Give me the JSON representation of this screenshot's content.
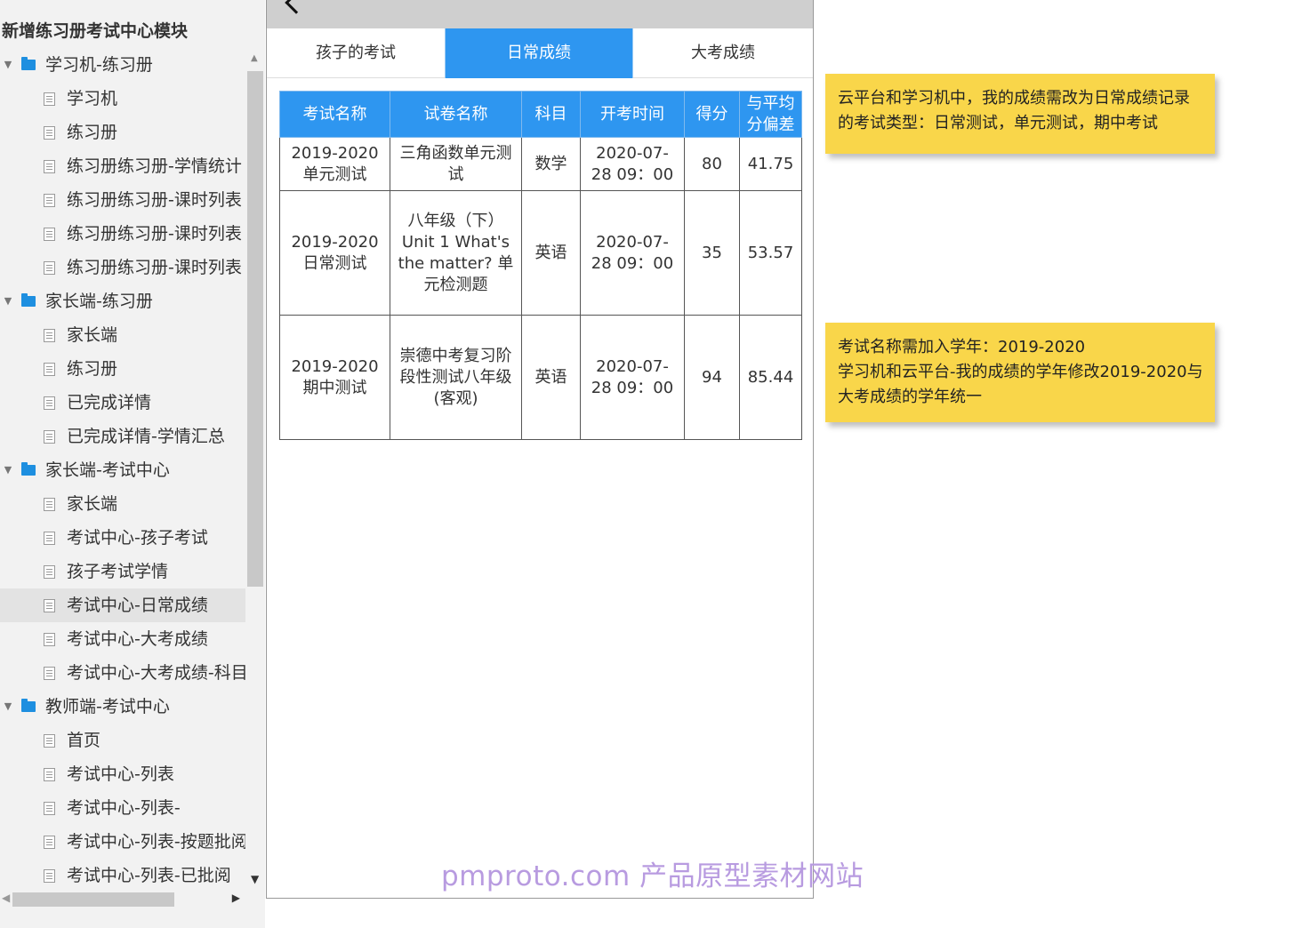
{
  "sidebar": {
    "title": "新增练习册考试中心模块",
    "tree": [
      {
        "type": "folder",
        "label": "学习机-练习册"
      },
      {
        "type": "page",
        "label": "学习机"
      },
      {
        "type": "page",
        "label": "练习册"
      },
      {
        "type": "page",
        "label": "练习册练习册-学情统计"
      },
      {
        "type": "page",
        "label": "练习册练习册-课时列表"
      },
      {
        "type": "page",
        "label": "练习册练习册-课时列表"
      },
      {
        "type": "page",
        "label": "练习册练习册-课时列表"
      },
      {
        "type": "folder",
        "label": "家长端-练习册"
      },
      {
        "type": "page",
        "label": "家长端"
      },
      {
        "type": "page",
        "label": "练习册"
      },
      {
        "type": "page",
        "label": "已完成详情"
      },
      {
        "type": "page",
        "label": "已完成详情-学情汇总"
      },
      {
        "type": "folder",
        "label": "家长端-考试中心"
      },
      {
        "type": "page",
        "label": "家长端"
      },
      {
        "type": "page",
        "label": "考试中心-孩子考试"
      },
      {
        "type": "page",
        "label": "孩子考试学情"
      },
      {
        "type": "page",
        "label": "考试中心-日常成绩",
        "selected": true
      },
      {
        "type": "page",
        "label": "考试中心-大考成绩"
      },
      {
        "type": "page",
        "label": "考试中心-大考成绩-科目"
      },
      {
        "type": "folder",
        "label": "教师端-考试中心"
      },
      {
        "type": "page",
        "label": "首页"
      },
      {
        "type": "page",
        "label": "考试中心-列表"
      },
      {
        "type": "page",
        "label": "考试中心-列表-"
      },
      {
        "type": "page",
        "label": "考试中心-列表-按题批阅"
      },
      {
        "type": "page",
        "label": "考试中心-列表-已批阅"
      }
    ]
  },
  "phone": {
    "tabs": [
      "孩子的考试",
      "日常成绩",
      "大考成绩"
    ],
    "active_tab": 1,
    "table": {
      "headers": [
        "考试名称",
        "试卷名称",
        "科目",
        "开考时间",
        "得分",
        "与平均分偏差"
      ],
      "rows": [
        [
          "2019-2020单元测试",
          "三角函数单元测试",
          "数学",
          "2020-07-28 09：00",
          "80",
          "41.75"
        ],
        [
          "2019-2020日常测试",
          "八年级（下）Unit 1 What's the matter? 单元检测题",
          "英语",
          "2020-07-28 09：00",
          "35",
          "53.57"
        ],
        [
          "2019-2020期中测试",
          "崇德中考复习阶段性测试八年级(客观)",
          "英语",
          "2020-07-28 09：00",
          "94",
          "85.44"
        ]
      ]
    }
  },
  "notes": {
    "note1": [
      "云平台和学习机中，我的成绩需改为日常成绩记录",
      "的考试类型：日常测试，单元测试，期中考试"
    ],
    "note2": [
      "考试名称需加入学年：2019-2020",
      "学习机和云平台-我的成绩的学年修改2019-2020与",
      "大考成绩的学年统一"
    ]
  },
  "watermark": "pmproto.com 产品原型素材网站",
  "colors": {
    "accent": "#2e96f0",
    "note": "#f9d64a",
    "folder": "#1e8fe0"
  },
  "icons": {
    "folder": "folder-icon",
    "page": "page-icon",
    "expand": "caret-down-icon",
    "back": "back-arrow-icon"
  }
}
